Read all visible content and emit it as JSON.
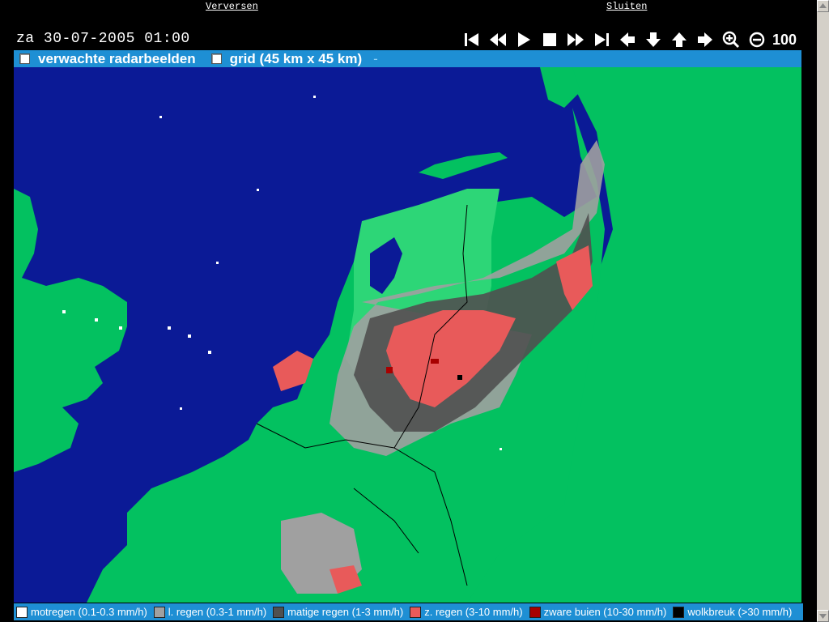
{
  "links": {
    "refresh": "Verversen",
    "close": "Sluiten"
  },
  "timestamp": "za 30-07-2005 01:00",
  "controls": {
    "icons": [
      "skip-first-icon",
      "rewind-icon",
      "play-icon",
      "stop-icon",
      "fast-forward-icon",
      "skip-last-icon",
      "pan-left-icon",
      "pan-down-icon",
      "pan-up-icon",
      "pan-right-icon",
      "zoom-in-icon",
      "zoom-out-icon"
    ],
    "zoom_level": "100"
  },
  "options": [
    {
      "label": "verwachte radarbeelden",
      "checked": false
    },
    {
      "label": "grid (45 km x 45 km)",
      "checked": false
    }
  ],
  "option_trailer": "-",
  "colors": {
    "sea": "#0b1a96",
    "land": "#03c160",
    "land_light": "#0fd070",
    "bar": "#1e8fd4"
  },
  "legend": [
    {
      "label": "motregen (0.1-0.3 mm/h)",
      "color": "#ffffff"
    },
    {
      "label": "l. regen (0.3-1 mm/h)",
      "color": "#a0a0a0"
    },
    {
      "label": "matige regen (1-3 mm/h)",
      "color": "#505050"
    },
    {
      "label": "z. regen (3-10 mm/h)",
      "color": "#e85a5a"
    },
    {
      "label": "zware buien (10-30 mm/h)",
      "color": "#a80000"
    },
    {
      "label": "wolkbreuk (>30 mm/h)",
      "color": "#000000"
    }
  ]
}
